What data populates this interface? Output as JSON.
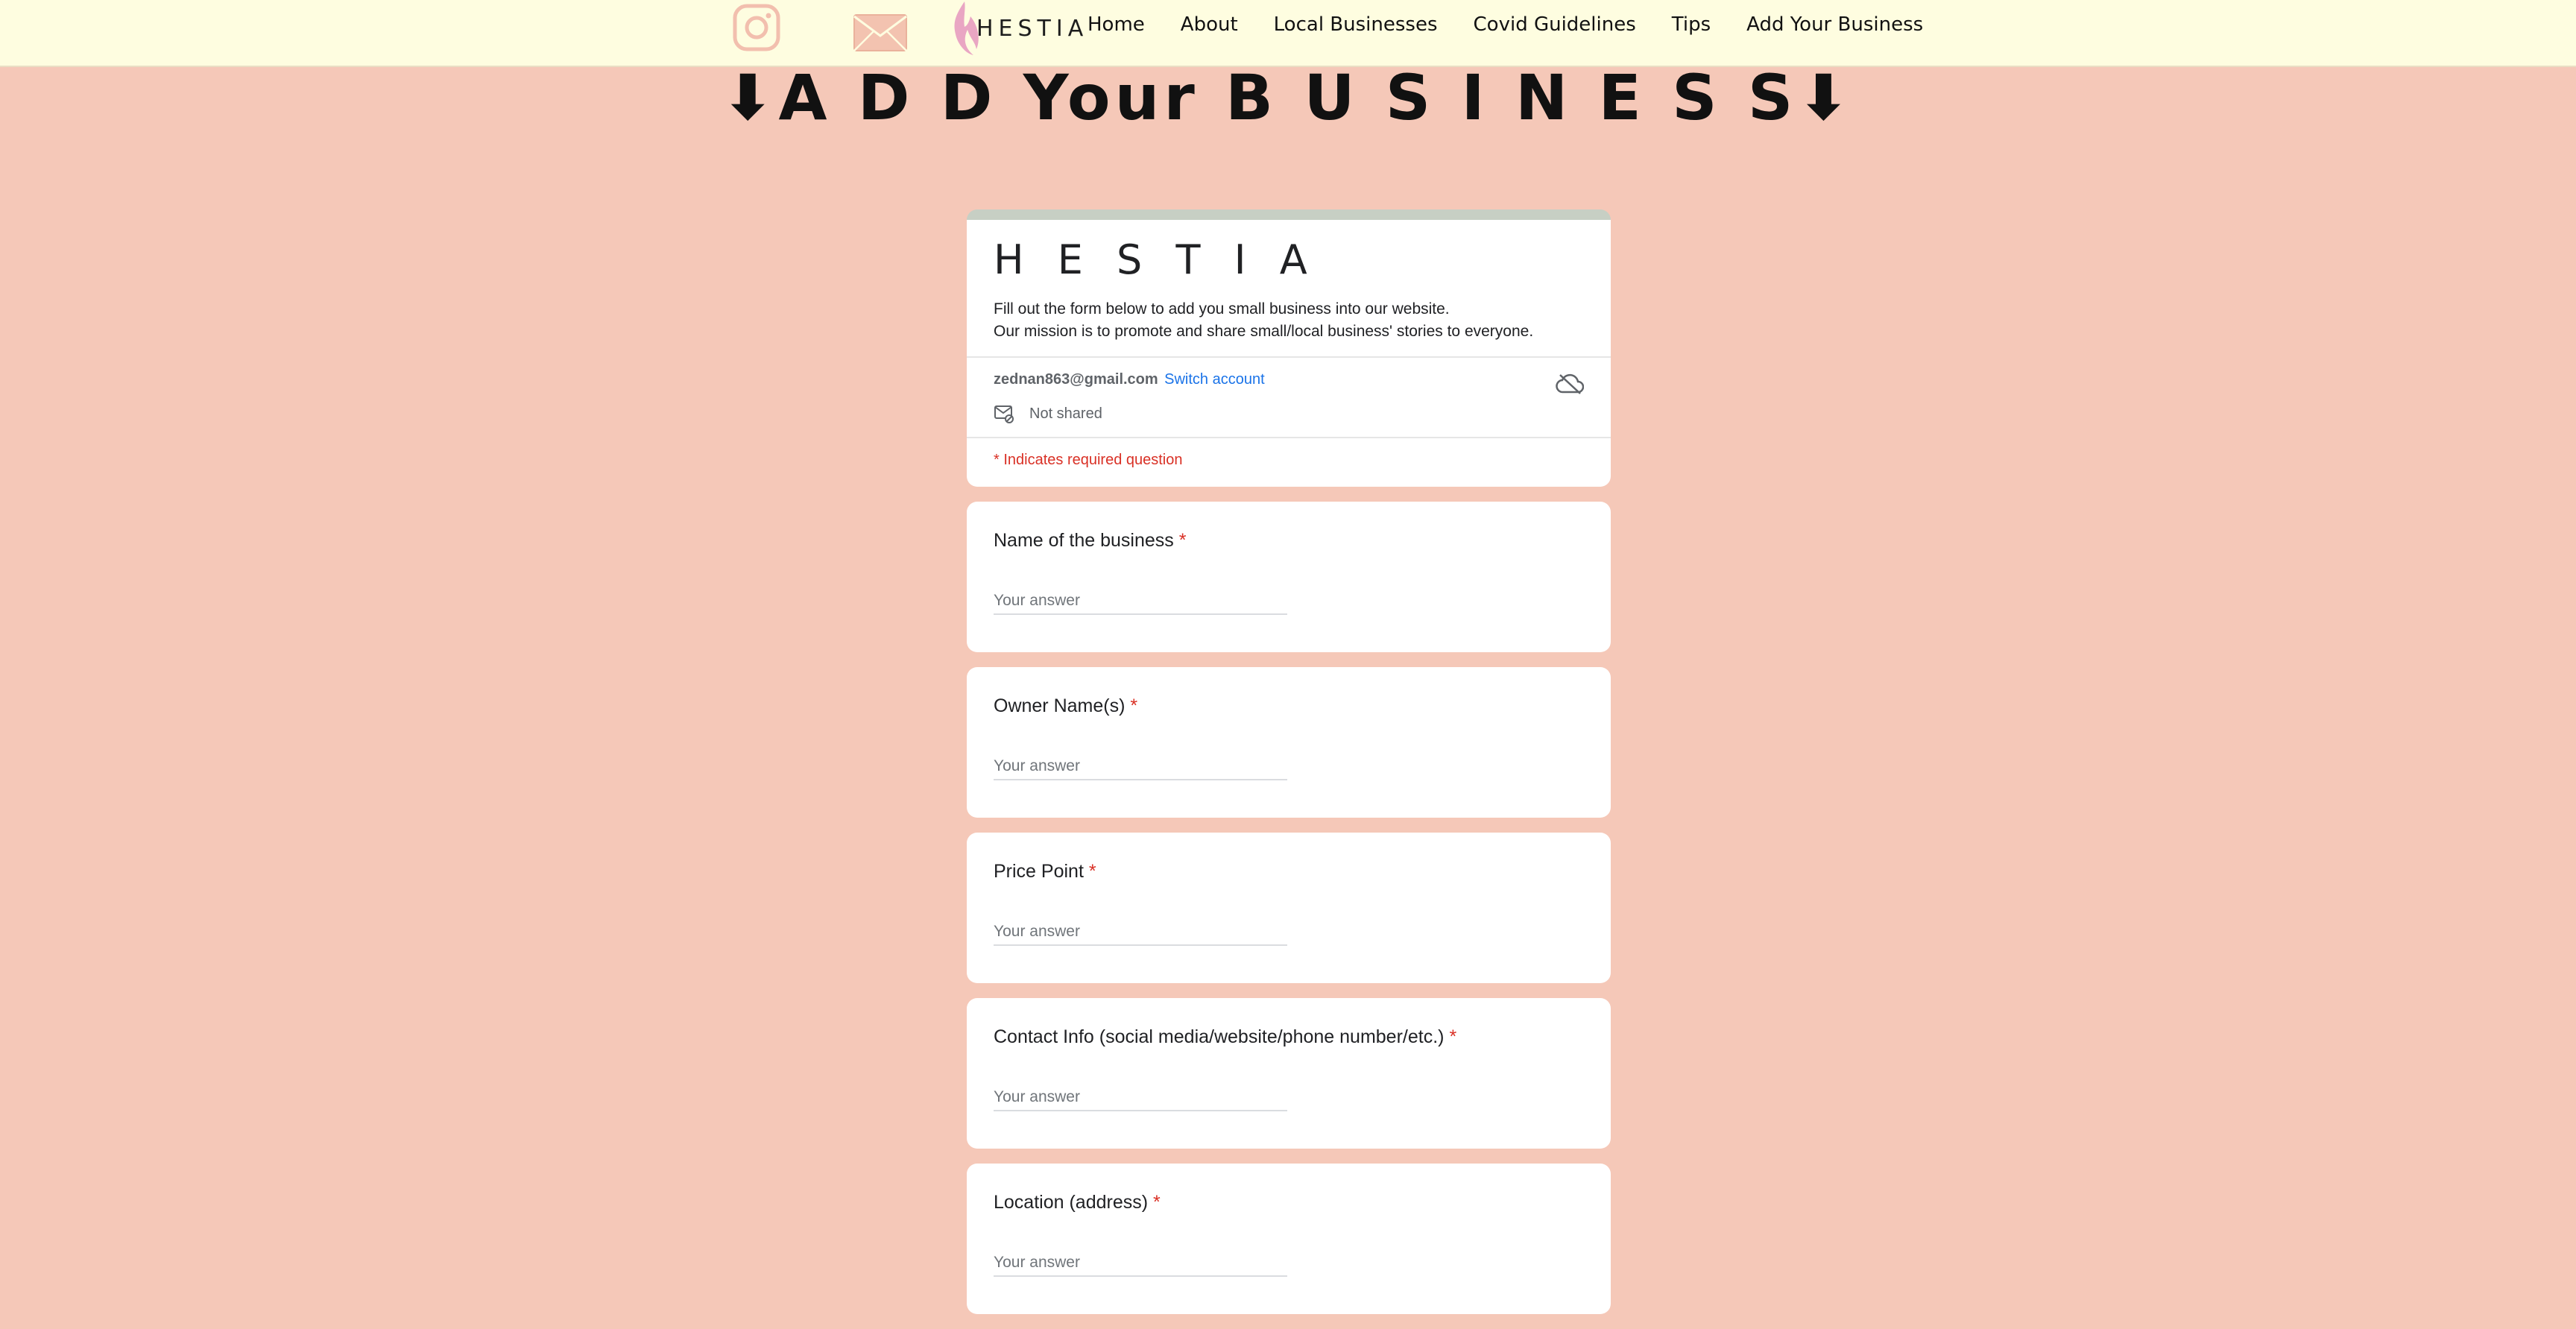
{
  "nav": {
    "brand": "HESTIA",
    "links": [
      "Home",
      "About",
      "Local Businesses",
      "Covid Guidelines",
      "Tips",
      "Add Your Business"
    ],
    "icons": [
      "instagram-icon",
      "mail-icon",
      "flame-logo-icon"
    ]
  },
  "page_heading": "⬇A D D Your B U S I N E S S⬇",
  "form": {
    "title": "H E S T I A",
    "description_line1": "Fill out the form below to add you small business into our website.",
    "description_line2": "Our mission is to promote and share small/local business' stories to everyone.",
    "email": "zednan863@gmail.com",
    "switch_account": "Switch account",
    "not_shared": "Not shared",
    "required_note": "* Indicates required question",
    "questions": [
      {
        "label": "Name of the business",
        "placeholder": "Your answer"
      },
      {
        "label": "Owner Name(s)",
        "placeholder": "Your answer"
      },
      {
        "label": "Price Point",
        "placeholder": "Your answer"
      },
      {
        "label": "Contact Info (social media/website/phone number/etc.)",
        "placeholder": "Your answer"
      },
      {
        "label": "Location (address)",
        "placeholder": "Your answer"
      }
    ],
    "required_star": "*"
  },
  "colors": {
    "page_bg": "#f5c8b8",
    "nav_bg": "#fefde0",
    "form_header_accent": "#c7cfc4",
    "required_red": "#d93025",
    "link_blue": "#1a73e8"
  }
}
